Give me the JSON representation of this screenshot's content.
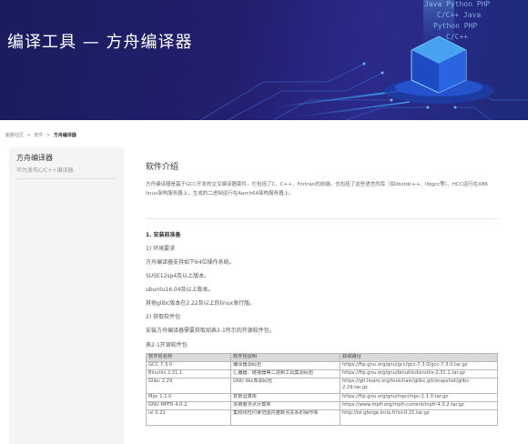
{
  "banner": {
    "title": "编译工具 — 方舟编译器",
    "code_lines": [
      "Java Python PHP",
      "C/C++ Java",
      "Python PHP",
      "C/C++"
    ]
  },
  "breadcrumb": [
    "鲲鹏社区",
    ">",
    "软件",
    ">",
    "方舟编译器"
  ],
  "sidebar": {
    "title": "方舟编译器",
    "subtitle": "华为发布C/C++编译器"
  },
  "content": {
    "heading": "软件介绍",
    "intro": "方舟编译器是基于GCC开发的交叉编译器套件，它包括了C、C++、Fortran的前端，也包括了这些语言的库（如libstdc++、libgcc等）。HCC运行在X86 linux架构服务器上，生成的二进制运行在Aarch64架构服务器上。",
    "section1": "1.   安装前准备",
    "sub1": "1)    环境要求",
    "env_lines": [
      "方舟编译器支持如下64位操作系统。",
      "SUSE12sp4及以上版本。",
      "ubuntu16.04及以上版本。",
      "其他glibc版本在2.22及以上的linux发行版。"
    ],
    "sub2": "2)    获取软件包",
    "get_line": "安装方舟编译器需要获取如表2-1所示的开源软件包。",
    "table_caption": "表2-1开源软件包"
  },
  "table": {
    "headers": [
      "软件包名称",
      "软件包说明",
      "获取路径"
    ],
    "rows": [
      [
        "GCC 7.3.0",
        "编译器源码包",
        "https://ftp.gnu.org/gnu/gcc/gcc-7.3.0/gcc-7.3.0.tar.gz"
      ],
      [
        "Binutils 2.31.1",
        "汇编器、链接器等二进制工具集源码包",
        "https://ftp.gnu.org/gnu/binutils/binutils-2.31.1.tar.gz"
      ],
      [
        "Glibc 2.29",
        "GNU libc库源码包",
        "https://git.linaro.org/toolchain/glibc.git/snapshot/glibc-2.29.tar.gz"
      ],
      [
        "Mpc 1.1.0",
        "复数运算库",
        "https://ftp.gnu.org/gnu/mpc/mpc-1.1.0.tar.gz"
      ],
      [
        "GNU MPFR 4.0.2",
        "多精度浮点计算库",
        "https://www.mpfr.org/mpfr-current/mpfr-4.0.2.tar.gz"
      ],
      [
        "isl 0.21",
        "集和线性约束范围内整数点关系的操作库",
        "http://isl.gforge.inria.fr/isl-0.21.tar.gz"
      ]
    ]
  },
  "colors": {
    "banner_dark": "#1a1c5e",
    "banner_accent": "#4fb3ff",
    "sidebar_bg": "#f4f4f6",
    "table_header_bg": "#d9d9d9"
  }
}
